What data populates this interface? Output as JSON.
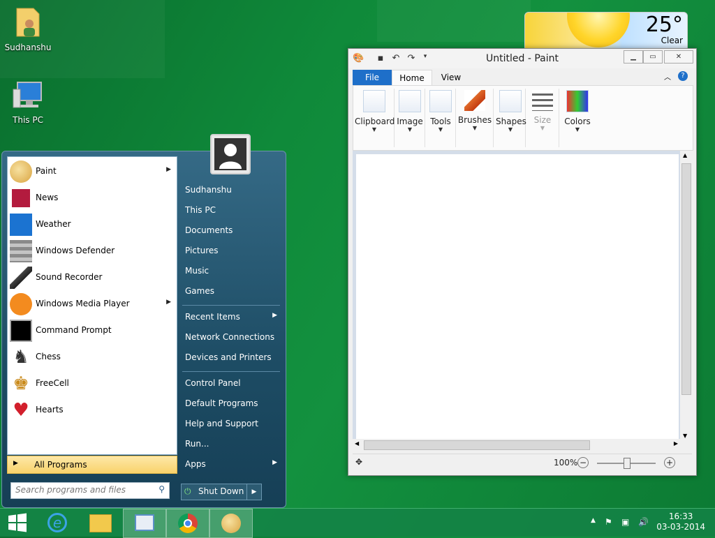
{
  "desktop": {
    "icons": [
      {
        "label": "Sudhanshu",
        "icon": "user-folder-icon"
      },
      {
        "label": "This PC",
        "icon": "computer-icon"
      }
    ]
  },
  "weather": {
    "temp": "25°",
    "condition": "Clear"
  },
  "paint": {
    "title": "Untitled - Paint",
    "tabs": [
      "File",
      "Home",
      "View"
    ],
    "groups": [
      {
        "label": "Clipboard",
        "icon": "clipboard-icon"
      },
      {
        "label": "Image",
        "icon": "image-select-icon"
      },
      {
        "label": "Tools",
        "icon": "tools-icon"
      },
      {
        "label": "Brushes",
        "icon": "brush-icon"
      },
      {
        "label": "Shapes",
        "icon": "shapes-icon"
      },
      {
        "label": "Size",
        "icon": "size-icon"
      },
      {
        "label": "Colors",
        "icon": "colors-icon"
      }
    ],
    "zoom": "100%"
  },
  "start_menu": {
    "programs": [
      {
        "label": "Paint",
        "icon": "paint-icon",
        "submenu": true
      },
      {
        "label": "News",
        "icon": "news-icon",
        "submenu": false
      },
      {
        "label": "Weather",
        "icon": "weather-icon",
        "submenu": false
      },
      {
        "label": "Windows Defender",
        "icon": "defender-icon",
        "submenu": false
      },
      {
        "label": "Sound Recorder",
        "icon": "microphone-icon",
        "submenu": false
      },
      {
        "label": "Windows Media Player",
        "icon": "media-player-icon",
        "submenu": true
      },
      {
        "label": "Command Prompt",
        "icon": "cmd-icon",
        "submenu": false
      },
      {
        "label": "Chess",
        "icon": "chess-icon",
        "submenu": false
      },
      {
        "label": "FreeCell",
        "icon": "freecell-icon",
        "submenu": false
      },
      {
        "label": "Hearts",
        "icon": "hearts-icon",
        "submenu": false
      }
    ],
    "all_programs": "All Programs",
    "search_placeholder": "Search programs and files",
    "right_links_a": [
      "Sudhanshu",
      "This PC",
      "Documents",
      "Pictures",
      "Music",
      "Games"
    ],
    "right_links_b": [
      "Recent Items",
      "Network Connections",
      "Devices and Printers"
    ],
    "right_links_c": [
      "Control Panel",
      "Default Programs",
      "Help and Support",
      "Run...",
      "Apps"
    ],
    "shutdown": "Shut Down"
  },
  "taskbar": {
    "clock_time": "16:33",
    "clock_date": "03-03-2014"
  }
}
